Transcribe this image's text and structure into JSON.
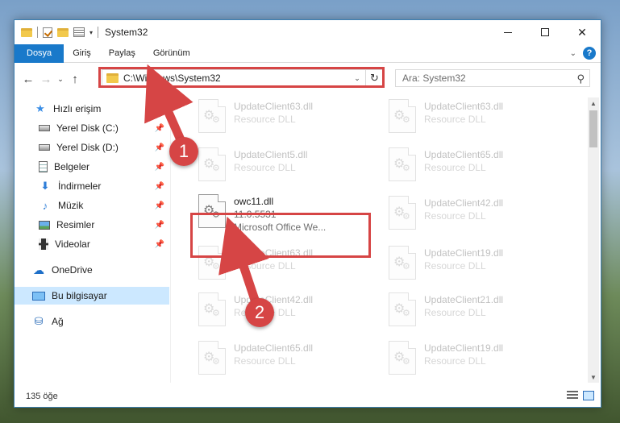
{
  "window": {
    "title": "System32",
    "controls": {
      "minimize": "—",
      "maximize": "☐",
      "close": "✕"
    }
  },
  "quick_access": {
    "caret": "▾"
  },
  "ribbon": {
    "tabs": [
      "Dosya",
      "Giriş",
      "Paylaş",
      "Görünüm"
    ],
    "expand": "⌄",
    "help": "?"
  },
  "nav": {
    "back": "←",
    "forward": "→",
    "recent": "⌄",
    "up": "↑",
    "address": "C:\\Windows\\System32",
    "address_dropdown": "⌄",
    "refresh": "↻",
    "search_placeholder": "Ara: System32",
    "search_icon": "⚲"
  },
  "sidebar": {
    "items": [
      {
        "label": "Hızlı erişim",
        "icon": "star-icon",
        "glyph": "★",
        "pinned": false
      },
      {
        "label": "Yerel Disk (C:)",
        "icon": "disk-icon",
        "glyph": "",
        "pinned": true
      },
      {
        "label": "Yerel Disk (D:)",
        "icon": "disk-icon",
        "glyph": "",
        "pinned": true
      },
      {
        "label": "Belgeler",
        "icon": "document-icon",
        "glyph": "",
        "pinned": true
      },
      {
        "label": "İndirmeler",
        "icon": "download-icon",
        "glyph": "⬇",
        "pinned": true
      },
      {
        "label": "Müzik",
        "icon": "music-icon",
        "glyph": "♪",
        "pinned": true
      },
      {
        "label": "Resimler",
        "icon": "picture-icon",
        "glyph": "",
        "pinned": true
      },
      {
        "label": "Videolar",
        "icon": "video-icon",
        "glyph": "",
        "pinned": true
      },
      {
        "label": "OneDrive",
        "icon": "cloud-icon",
        "glyph": "☁",
        "pinned": false
      },
      {
        "label": "Bu bilgisayar",
        "icon": "computer-icon",
        "glyph": "",
        "pinned": false,
        "selected": true
      },
      {
        "label": "Ağ",
        "icon": "network-icon",
        "glyph": "⛁",
        "pinned": false
      }
    ],
    "pin_glyph": "📌"
  },
  "files": [
    {
      "name": "UpdateClient63.dll",
      "sub": "Resource DLL",
      "faded": true
    },
    {
      "name": "UpdateClient63.dll",
      "sub": "Resource DLL",
      "faded": true
    },
    {
      "name": "UpdateClient5.dll",
      "sub": "Resource DLL",
      "faded": true
    },
    {
      "name": "UpdateClient65.dll",
      "sub": "Resource DLL",
      "faded": true
    },
    {
      "name": "owc11.dll",
      "sub": "11.0.5531",
      "desc": "Microsoft Office We...",
      "faded": false
    },
    {
      "name": "UpdateClient42.dll",
      "sub": "Resource DLL",
      "faded": true
    },
    {
      "name": "UpdateClient63.dll",
      "sub": "Resource DLL",
      "faded": true
    },
    {
      "name": "UpdateClient19.dll",
      "sub": "Resource DLL",
      "faded": true
    },
    {
      "name": "UpdateClient42.dll",
      "sub": "Resource DLL",
      "faded": true
    },
    {
      "name": "UpdateClient21.dll",
      "sub": "Resource DLL",
      "faded": true
    },
    {
      "name": "UpdateClient65.dll",
      "sub": "Resource DLL",
      "faded": true
    },
    {
      "name": "UpdateClient19.dll",
      "sub": "Resource DLL",
      "faded": true
    }
  ],
  "file_icon": {
    "gear_large": "⚙",
    "gear_small": "⚙"
  },
  "scrollbar": {
    "up": "▲",
    "down": "▼"
  },
  "status": {
    "count": "135 öğe"
  },
  "annotations": {
    "step1": "1",
    "step2": "2",
    "accent": "#d64545"
  }
}
